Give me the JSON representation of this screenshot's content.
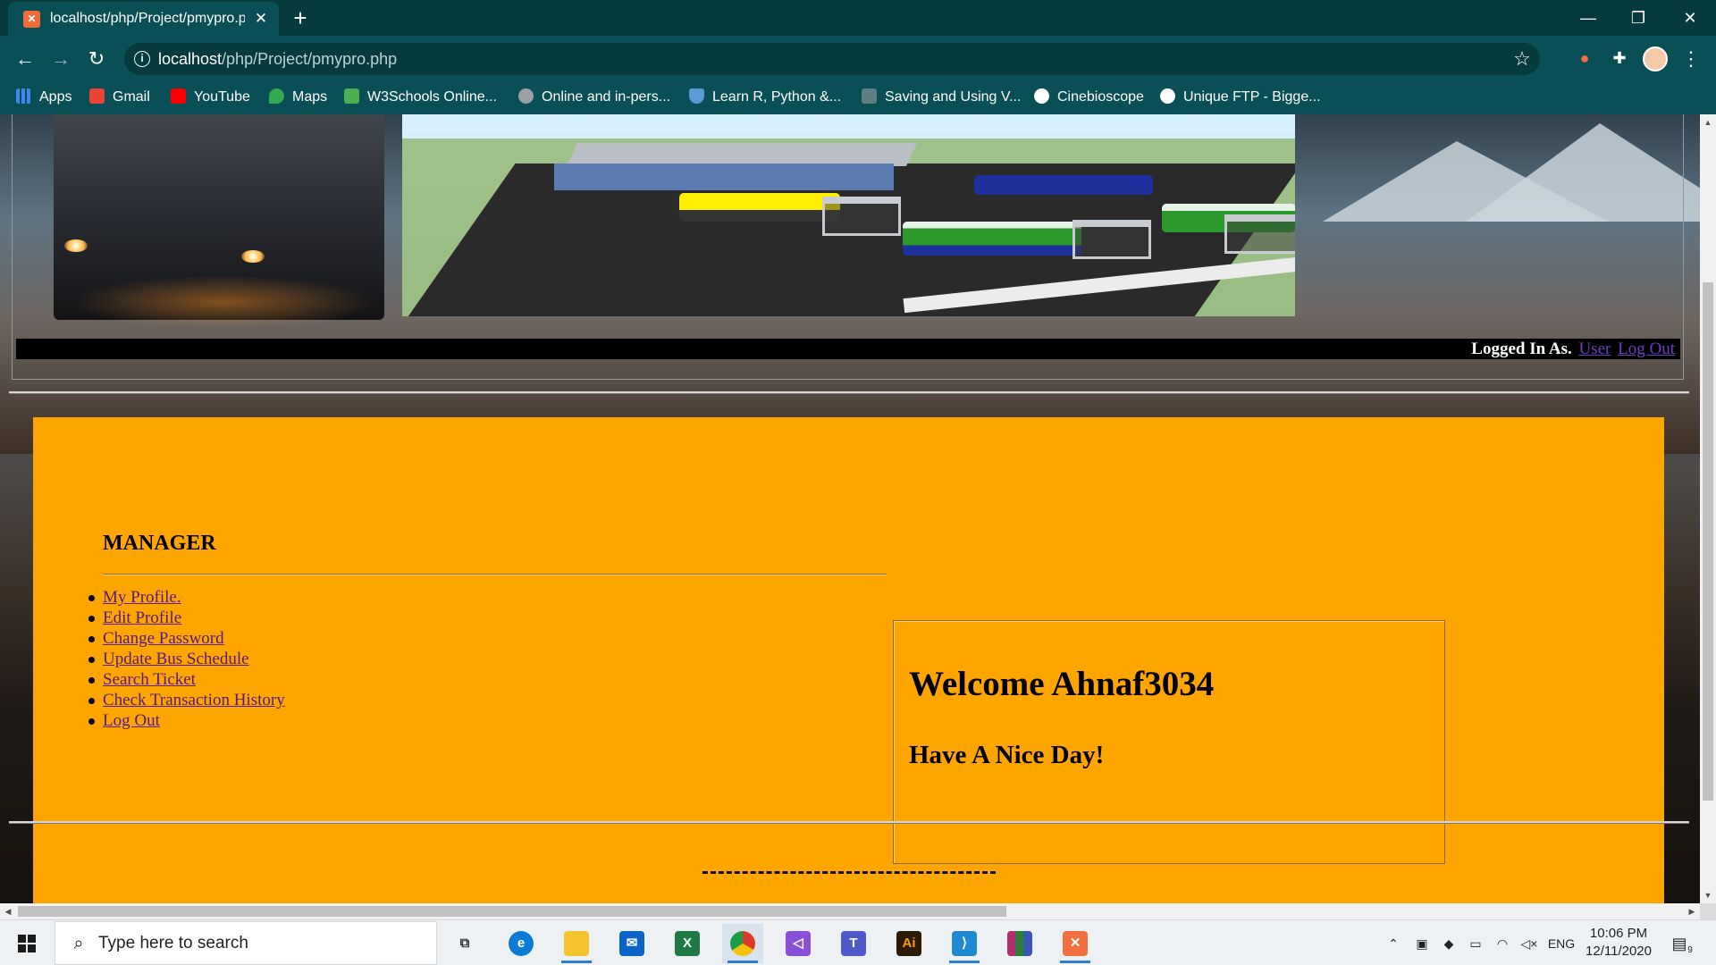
{
  "browser": {
    "tab_title": "localhost/php/Project/pmypro.pl",
    "tab_favicon": "xampp-icon",
    "url_host": "localhost",
    "url_path": "/php/Project/pmypro.php",
    "bookmarks": [
      {
        "label": "Apps",
        "icon": "apps-grid-icon",
        "color": "#4285f4"
      },
      {
        "label": "Gmail",
        "icon": "gmail-icon",
        "color": "#ea4335"
      },
      {
        "label": "YouTube",
        "icon": "youtube-icon",
        "color": "#ff0000"
      },
      {
        "label": "Maps",
        "icon": "maps-pin-icon",
        "color": "#34a853"
      },
      {
        "label": "W3Schools Online...",
        "icon": "w3schools-icon",
        "color": "#4caf50"
      },
      {
        "label": "Online and in-pers...",
        "icon": "globe-icon",
        "color": "#9aa0a6"
      },
      {
        "label": "Learn R, Python &...",
        "icon": "shield-icon",
        "color": "#5b9bd5"
      },
      {
        "label": "Saving and Using V...",
        "icon": "link-icon",
        "color": "#9aa0a6"
      },
      {
        "label": "Cinebioscope",
        "icon": "globe-icon",
        "color": "#ffffff"
      },
      {
        "label": "Unique FTP - Bigge...",
        "icon": "globe-icon",
        "color": "#ffffff"
      }
    ]
  },
  "page": {
    "login": {
      "prefix": "Logged In As.",
      "user_link": "User",
      "logout_link": "Log Out"
    },
    "manager_title": "MANAGER",
    "menu": [
      "My Profile.",
      "Edit Profile",
      "Change Password",
      "Update Bus Schedule",
      "Search Ticket",
      "Check Transaction History",
      "Log Out"
    ],
    "welcome_title": "Welcome Ahnaf3034",
    "welcome_sub": "Have A Nice Day!",
    "panel_color": "#ffa500",
    "link_color": "#551a8b"
  },
  "taskbar": {
    "search_placeholder": "Type here to search",
    "apps": [
      {
        "icon": "task-view-icon",
        "color": "#333333"
      },
      {
        "icon": "edge-icon",
        "color": "#0c7bd3"
      },
      {
        "icon": "file-explorer-icon",
        "color": "#f4c430"
      },
      {
        "icon": "mail-icon",
        "color": "#0a64c8"
      },
      {
        "icon": "excel-icon",
        "color": "#1f7a46"
      },
      {
        "icon": "chrome-icon",
        "color": "#d93a2b"
      },
      {
        "icon": "visual-studio-icon",
        "color": "#8a4fd8"
      },
      {
        "icon": "teams-icon",
        "color": "#5059c9"
      },
      {
        "icon": "illustrator-icon",
        "color": "#2a1a06"
      },
      {
        "icon": "vscode-icon",
        "color": "#1f8ad2"
      },
      {
        "icon": "winrar-icon",
        "color": "#b32c6e"
      },
      {
        "icon": "xampp-icon",
        "color": "#f0703f"
      }
    ],
    "tray": {
      "language": "ENG",
      "time": "10:06 PM",
      "date": "12/11/2020",
      "notifications": "9"
    }
  }
}
